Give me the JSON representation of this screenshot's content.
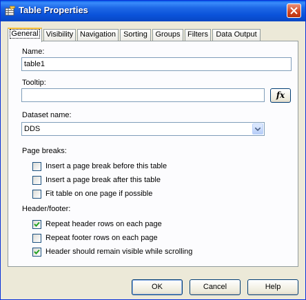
{
  "window": {
    "title": "Table Properties"
  },
  "tabs": [
    {
      "label": "General",
      "active": true
    },
    {
      "label": "Visibility"
    },
    {
      "label": "Navigation"
    },
    {
      "label": "Sorting"
    },
    {
      "label": "Groups"
    },
    {
      "label": "Filters"
    },
    {
      "label": "Data Output"
    }
  ],
  "general": {
    "name_label": "Name:",
    "name_value": "table1",
    "tooltip_label": "Tooltip:",
    "tooltip_value": "",
    "fx_label": "fx",
    "dataset_label": "Dataset name:",
    "dataset_value": "DDS",
    "page_breaks": {
      "label": "Page breaks:",
      "options": [
        {
          "label": "Insert a page break before this table",
          "checked": false
        },
        {
          "label": "Insert a page break after this table",
          "checked": false
        },
        {
          "label": "Fit table on one page if possible",
          "checked": false
        }
      ]
    },
    "header_footer": {
      "label": "Header/footer:",
      "options": [
        {
          "label": "Repeat header rows on each page",
          "checked": true
        },
        {
          "label": "Repeat footer rows on each page",
          "checked": false
        },
        {
          "label": "Header should remain visible while scrolling",
          "checked": true
        }
      ]
    }
  },
  "buttons": {
    "ok": "OK",
    "cancel": "Cancel",
    "help": "Help"
  },
  "colors": {
    "titlebar": "#0a52d9",
    "dialog_bg": "#ece9d8",
    "panel_bg": "#fcfcfe",
    "check": "#21a121",
    "active_tab_accent": "#ffc73c"
  }
}
